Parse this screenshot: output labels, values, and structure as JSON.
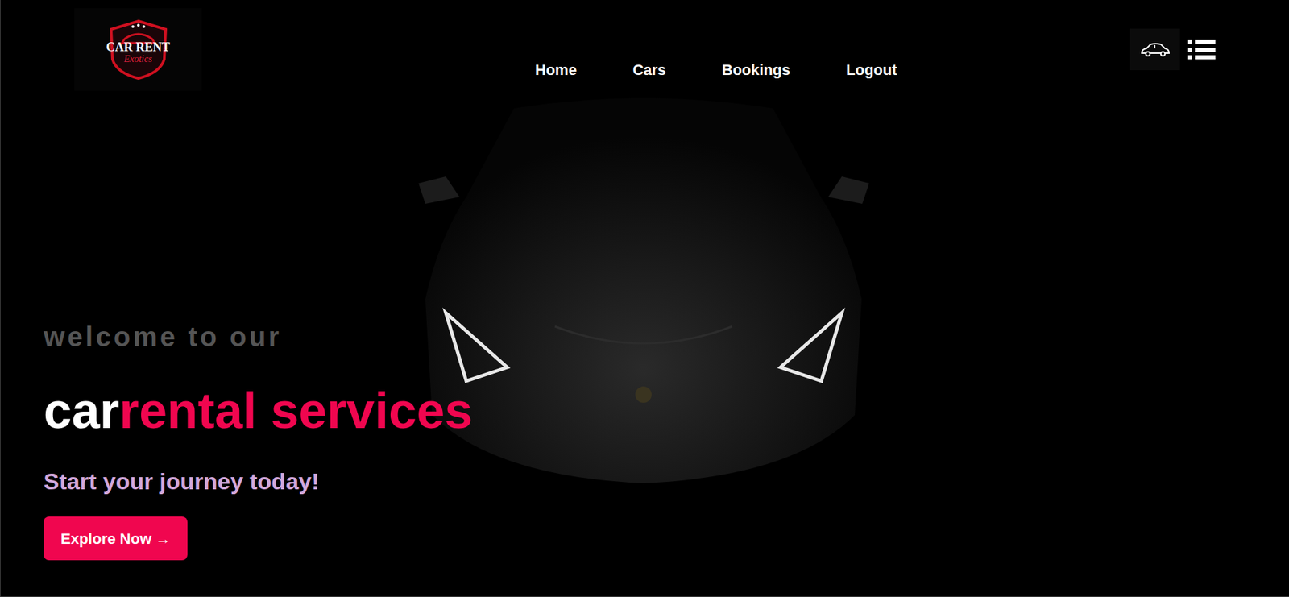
{
  "logo": {
    "title": "CAR RENT",
    "subtitle": "Exotics"
  },
  "nav": [
    {
      "label": "Home"
    },
    {
      "label": "Cars"
    },
    {
      "label": "Bookings"
    },
    {
      "label": "Logout"
    }
  ],
  "hero": {
    "welcome": "welcome to our",
    "title_white": "car",
    "title_accent": "rental services",
    "tagline": "Start your journey today!",
    "button": "Explore Now →"
  }
}
